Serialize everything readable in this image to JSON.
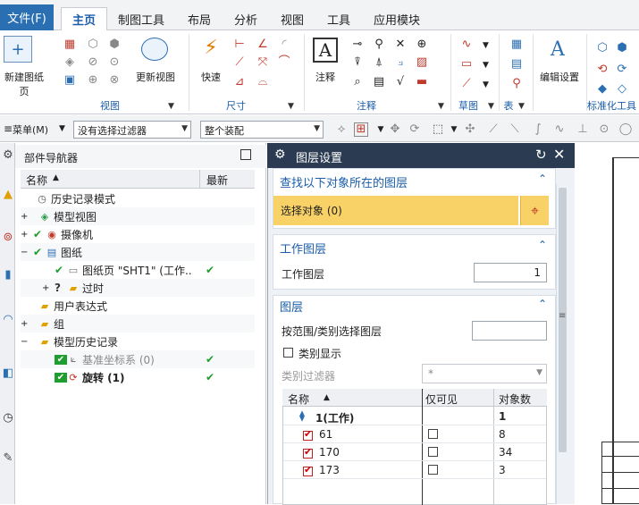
{
  "menubar": {
    "file": "文件(F)",
    "tabs": [
      "主页",
      "制图工具",
      "布局",
      "分析",
      "视图",
      "工具",
      "应用模块"
    ],
    "active_tab": "主页"
  },
  "ribbon": {
    "new_sheet": "新建图纸页",
    "update_view": "更新视图",
    "quick": "快速",
    "annotation": "注释",
    "edit_settings": "编辑设置",
    "groups": [
      "视图",
      "尺寸",
      "注释",
      "草图",
      "表",
      "标准化工具"
    ]
  },
  "toolbar2": {
    "menu": "菜单(M)",
    "filter": "没有选择过滤器",
    "assembly": "整个装配"
  },
  "navigator": {
    "title": "部件导航器",
    "col_name": "名称",
    "col_latest": "最新",
    "rows": [
      {
        "label": "历史记录模式",
        "icon": "clock-icon",
        "latest": ""
      },
      {
        "label": "模型视图",
        "icon": "model-views-icon",
        "latest": ""
      },
      {
        "label": "摄像机",
        "icon": "camera-icon",
        "latest": ""
      },
      {
        "label": "图纸",
        "icon": "drawing-icon",
        "latest": ""
      },
      {
        "label": "图纸页 \"SHT1\" (工作...",
        "icon": "sheet-icon",
        "latest": "✔"
      },
      {
        "label": "过时",
        "icon": "folder-icon",
        "latest": ""
      },
      {
        "label": "用户表达式",
        "icon": "folder-icon",
        "latest": ""
      },
      {
        "label": "组",
        "icon": "folder-icon",
        "latest": ""
      },
      {
        "label": "模型历史记录",
        "icon": "folder-icon",
        "latest": ""
      },
      {
        "label": "基准坐标系 (0)",
        "icon": "datum-csys-icon",
        "latest": "✔"
      },
      {
        "label": "旋转 (1)",
        "icon": "revolve-icon",
        "latest": "✔"
      }
    ]
  },
  "dialog": {
    "title": "图层设置",
    "section1_title": "查找以下对象所在的图层",
    "select_object": "选择对象 (0)",
    "section2_title": "工作图层",
    "work_layer_label": "工作图层",
    "work_layer_value": "1",
    "section3_title": "图层",
    "range_label": "按范围/类别选择图层",
    "category_display": "类别显示",
    "category_filter": "类别过滤器",
    "category_filter_value": "*",
    "table_headers": [
      "名称",
      "仅可见",
      "对象数"
    ],
    "layers": [
      {
        "name": "1(工作)",
        "count": "1"
      },
      {
        "name": "61",
        "count": "8"
      },
      {
        "name": "170",
        "count": "34"
      },
      {
        "name": "173",
        "count": "3"
      }
    ]
  },
  "colors": {
    "accent": "#1a5da8",
    "file_bg": "#2b6fb3",
    "dialog_title_bg": "#2a3b52",
    "select_highlight": "#f8d266",
    "check_green": "#1f9d2f"
  }
}
